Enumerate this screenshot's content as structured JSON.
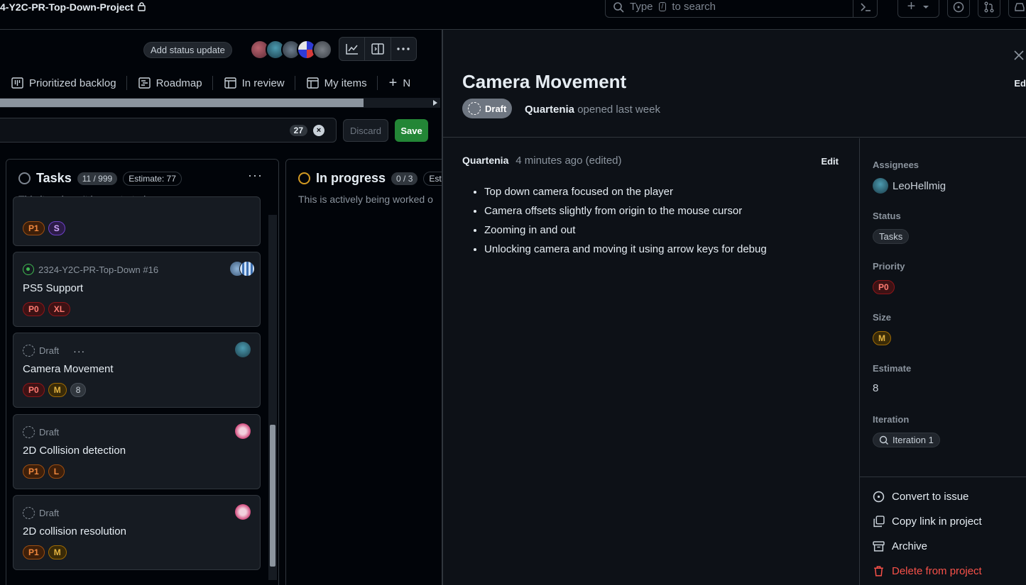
{
  "topbar": {
    "project_title": "4-Y2C-PR-Top-Down-Project",
    "search_pre": "Type",
    "search_key": "/",
    "search_post": "to search"
  },
  "toolbar": {
    "status_update": "Add status update"
  },
  "tabs": [
    {
      "label": "Prioritized backlog",
      "icon": "project-board-icon"
    },
    {
      "label": "Roadmap",
      "icon": "roadmap-icon"
    },
    {
      "label": "In review",
      "icon": "table-icon"
    },
    {
      "label": "My items",
      "icon": "table-icon"
    },
    {
      "label": "N",
      "icon": "plus-icon"
    }
  ],
  "filter": {
    "count": "27",
    "discard": "Discard",
    "save": "Save"
  },
  "columns": [
    {
      "title": "Tasks",
      "count": "11 / 999",
      "estimate": "Estimate: 77",
      "description": "This item hasn't been started"
    },
    {
      "title": "In progress",
      "count": "0 / 3",
      "estimate": "Esti",
      "description": "This is actively being worked o"
    }
  ],
  "cards": [
    {
      "meta": "",
      "title": "",
      "labels": [
        "P1",
        "S"
      ]
    },
    {
      "meta": "2324-Y2C-PR-Top-Down #16",
      "title": "PS5 Support",
      "labels": [
        "P0",
        "XL"
      ]
    },
    {
      "meta": "Draft",
      "title": "Camera Movement",
      "labels": [
        "P0",
        "M",
        "8"
      ]
    },
    {
      "meta": "Draft",
      "title": "2D Collision detection",
      "labels": [
        "P1",
        "L"
      ]
    },
    {
      "meta": "Draft",
      "title": "2D collision resolution",
      "labels": [
        "P1",
        "M"
      ]
    }
  ],
  "panel": {
    "title": "Camera Movement",
    "state": "Draft",
    "opened_by": "Quartenia",
    "opened_when": "opened last week",
    "edit_label": "Ed",
    "comment": {
      "author": "Quartenia",
      "time": "4 minutes ago (edited)",
      "edit": "Edit",
      "bullets": [
        "Top down camera focused on the player",
        "Camera offsets slightly from origin to the mouse cursor",
        "Zooming in and out",
        "Unlocking camera and moving it using arrow keys for debug"
      ]
    },
    "fields": {
      "assignees_label": "Assignees",
      "assignee": "LeoHellmig",
      "status_label": "Status",
      "status": "Tasks",
      "priority_label": "Priority",
      "priority": "P0",
      "size_label": "Size",
      "size": "M",
      "estimate_label": "Estimate",
      "estimate": "8",
      "iteration_label": "Iteration",
      "iteration": "Iteration 1"
    },
    "actions": {
      "convert": "Convert to issue",
      "copy_link": "Copy link in project",
      "archive": "Archive",
      "delete": "Delete from project"
    }
  },
  "colors": {
    "accent_green": "#238636",
    "danger": "#f85149",
    "in_progress": "#d29922"
  }
}
